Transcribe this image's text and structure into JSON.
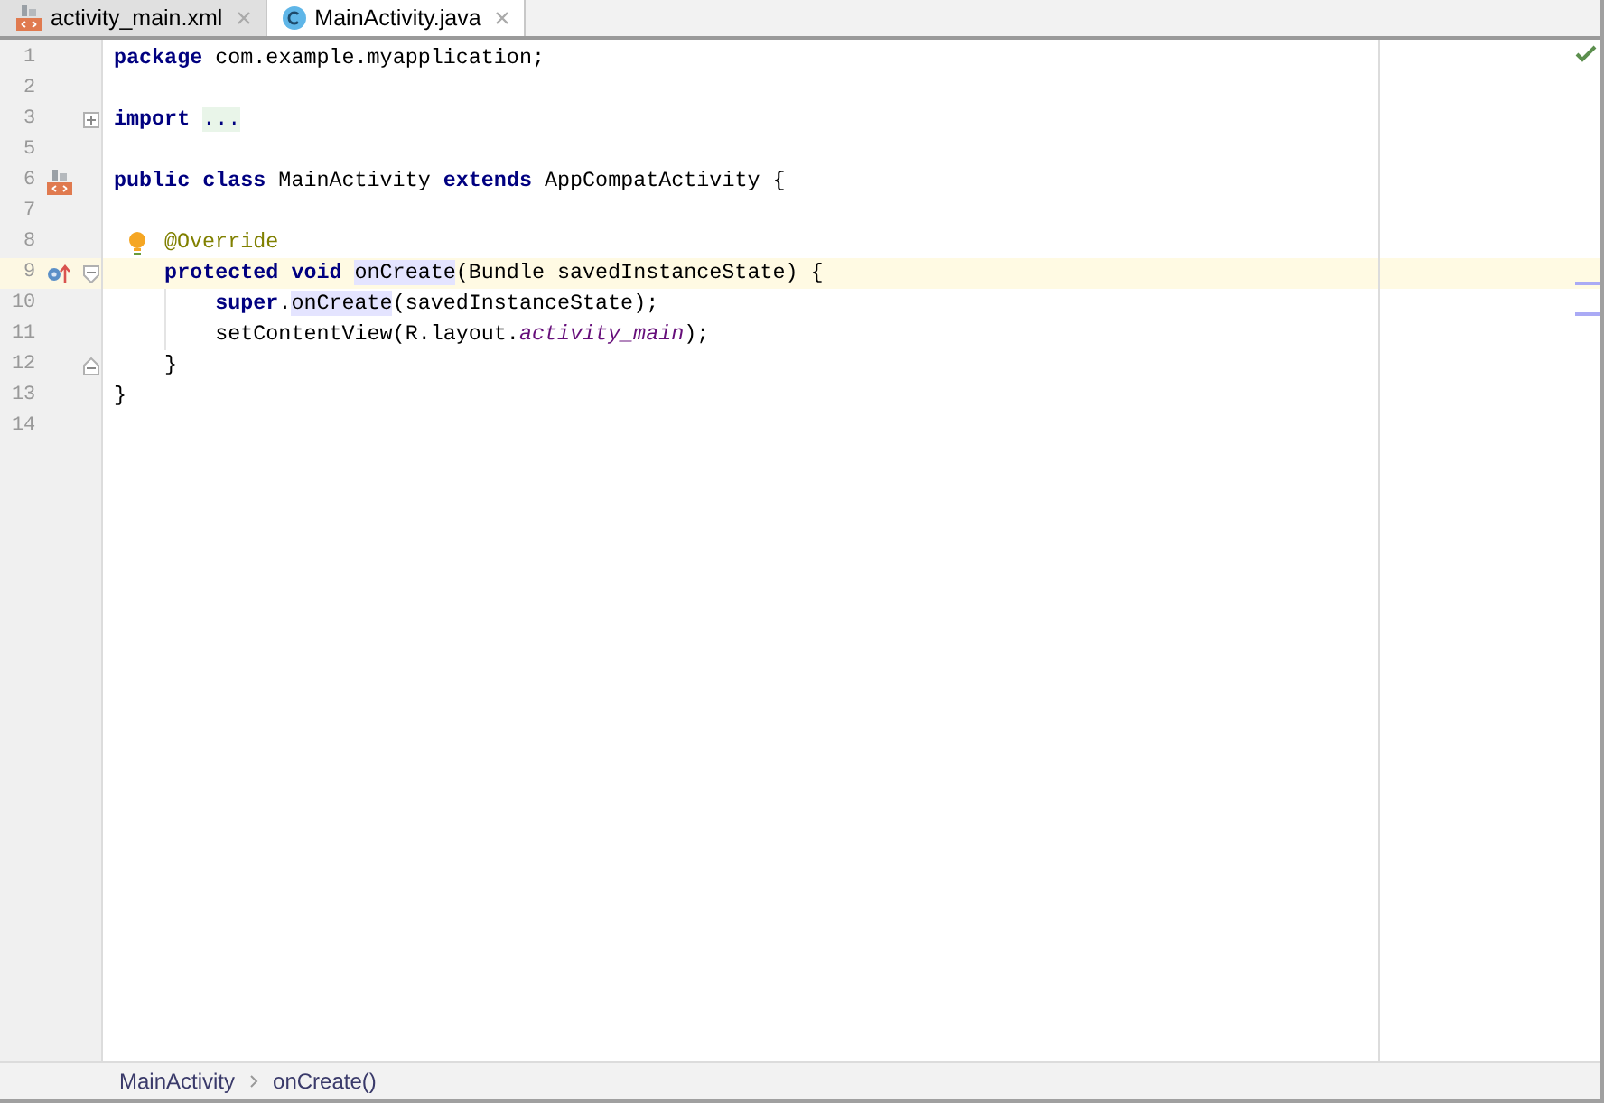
{
  "tabs": [
    {
      "label": "activity_main.xml",
      "kind": "layout",
      "selected": false
    },
    {
      "label": "MainActivity.java",
      "kind": "class",
      "selected": true
    }
  ],
  "editor": {
    "lines": [
      {
        "number": "1",
        "tokens": [
          {
            "text": "package",
            "kind": "keyword"
          },
          {
            "text": " com.example.myapplication;",
            "kind": "plain"
          }
        ]
      },
      {
        "number": "2"
      },
      {
        "number": "3",
        "icons": [
          {
            "kind": "expand"
          }
        ],
        "tokens": [
          {
            "text": "import ",
            "kind": "keyword"
          },
          {
            "text": "...",
            "kind": "folded"
          }
        ]
      },
      {
        "number": "5"
      },
      {
        "number": "6",
        "icons": [
          {
            "kind": "layout"
          }
        ],
        "tokens": [
          {
            "text": "public class",
            "kind": "keyword"
          },
          {
            "text": " MainActivity ",
            "kind": "plain"
          },
          {
            "text": "extends",
            "kind": "keyword"
          },
          {
            "text": " AppCompatActivity {",
            "kind": "plain"
          }
        ]
      },
      {
        "number": "7"
      },
      {
        "number": "8",
        "bulb": true,
        "tokens": [
          {
            "text": "@Override",
            "kind": "annotation"
          }
        ]
      },
      {
        "number": "9",
        "current": true,
        "icons": [
          {
            "kind": "override"
          },
          {
            "kind": "collapse"
          }
        ],
        "tokens": [
          {
            "text": "    protected void ",
            "kind": "keyword"
          },
          {
            "text": "onCreate",
            "kind": "usage"
          },
          {
            "text": "(Bundle savedInstanceState) {",
            "kind": "plain"
          }
        ]
      },
      {
        "number": "10",
        "guide": true,
        "tokens": [
          {
            "text": "        super",
            "kind": "keyword"
          },
          {
            "text": ".",
            "kind": "plain"
          },
          {
            "text": "onCreate",
            "kind": "usage"
          },
          {
            "text": "(savedInstanceState);",
            "kind": "plain"
          }
        ]
      },
      {
        "number": "11",
        "guide": true,
        "tokens": [
          {
            "text": "        setContentView(R.layout.",
            "kind": "plain"
          },
          {
            "text": "activity_main",
            "kind": "field"
          },
          {
            "text": ");",
            "kind": "plain"
          }
        ]
      },
      {
        "number": "12",
        "icons": [
          {
            "kind": "end"
          }
        ],
        "tokens": [
          {
            "text": "    }",
            "kind": "plain"
          }
        ]
      },
      {
        "number": "13",
        "tokens": [
          {
            "text": "}",
            "kind": "plain"
          }
        ]
      },
      {
        "number": "14"
      }
    ]
  },
  "breadcrumbs": [
    "MainActivity",
    "onCreate()"
  ]
}
